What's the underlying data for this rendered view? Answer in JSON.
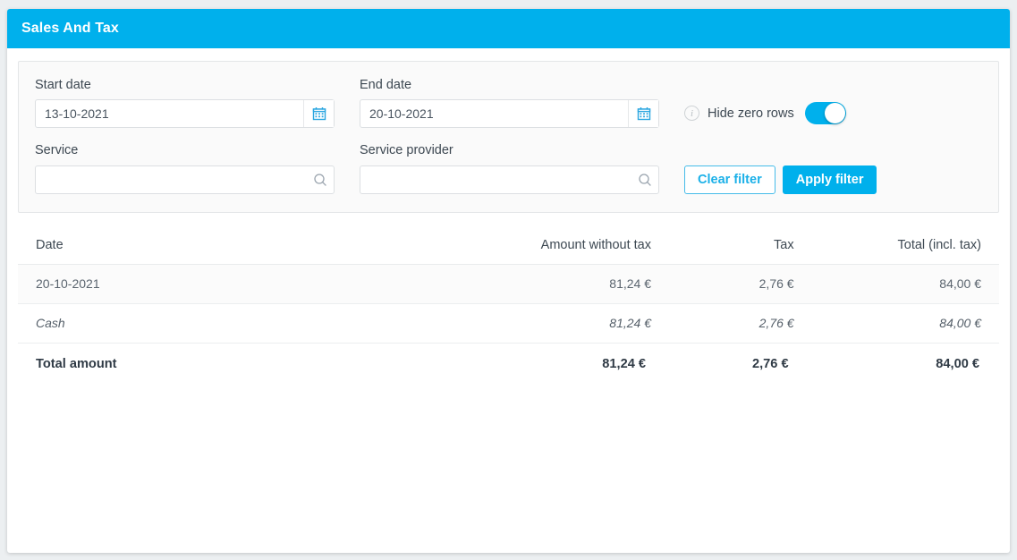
{
  "header": {
    "title": "Sales And Tax"
  },
  "filters": {
    "start_date": {
      "label": "Start date",
      "value": "13-10-2021",
      "icon": "calendar-icon"
    },
    "end_date": {
      "label": "End date",
      "value": "20-10-2021",
      "icon": "calendar-icon"
    },
    "hide_zero_rows": {
      "label": "Hide zero rows",
      "enabled": true,
      "info_icon": "info-icon"
    },
    "service": {
      "label": "Service",
      "value": "",
      "placeholder": "",
      "icon": "search-icon"
    },
    "service_provider": {
      "label": "Service provider",
      "value": "",
      "placeholder": "",
      "icon": "search-icon"
    },
    "clear_button": "Clear filter",
    "apply_button": "Apply filter"
  },
  "table": {
    "columns": [
      "Date",
      "Amount without tax",
      "Tax",
      "Total (incl. tax)"
    ],
    "rows": [
      {
        "date": "20-10-2021",
        "amount": "81,24 €",
        "tax": "2,76 €",
        "total": "84,00 €"
      },
      {
        "date": "Cash",
        "amount": "81,24 €",
        "tax": "2,76 €",
        "total": "84,00 €"
      }
    ],
    "total_row": {
      "label": "Total amount",
      "amount": "81,24 €",
      "tax": "2,76 €",
      "total": "84,00 €"
    }
  },
  "colors": {
    "accent": "#00b0ec",
    "header_bg": "#00b0ec",
    "panel_bg": "#fafafa",
    "page_bg": "#eceff1"
  }
}
